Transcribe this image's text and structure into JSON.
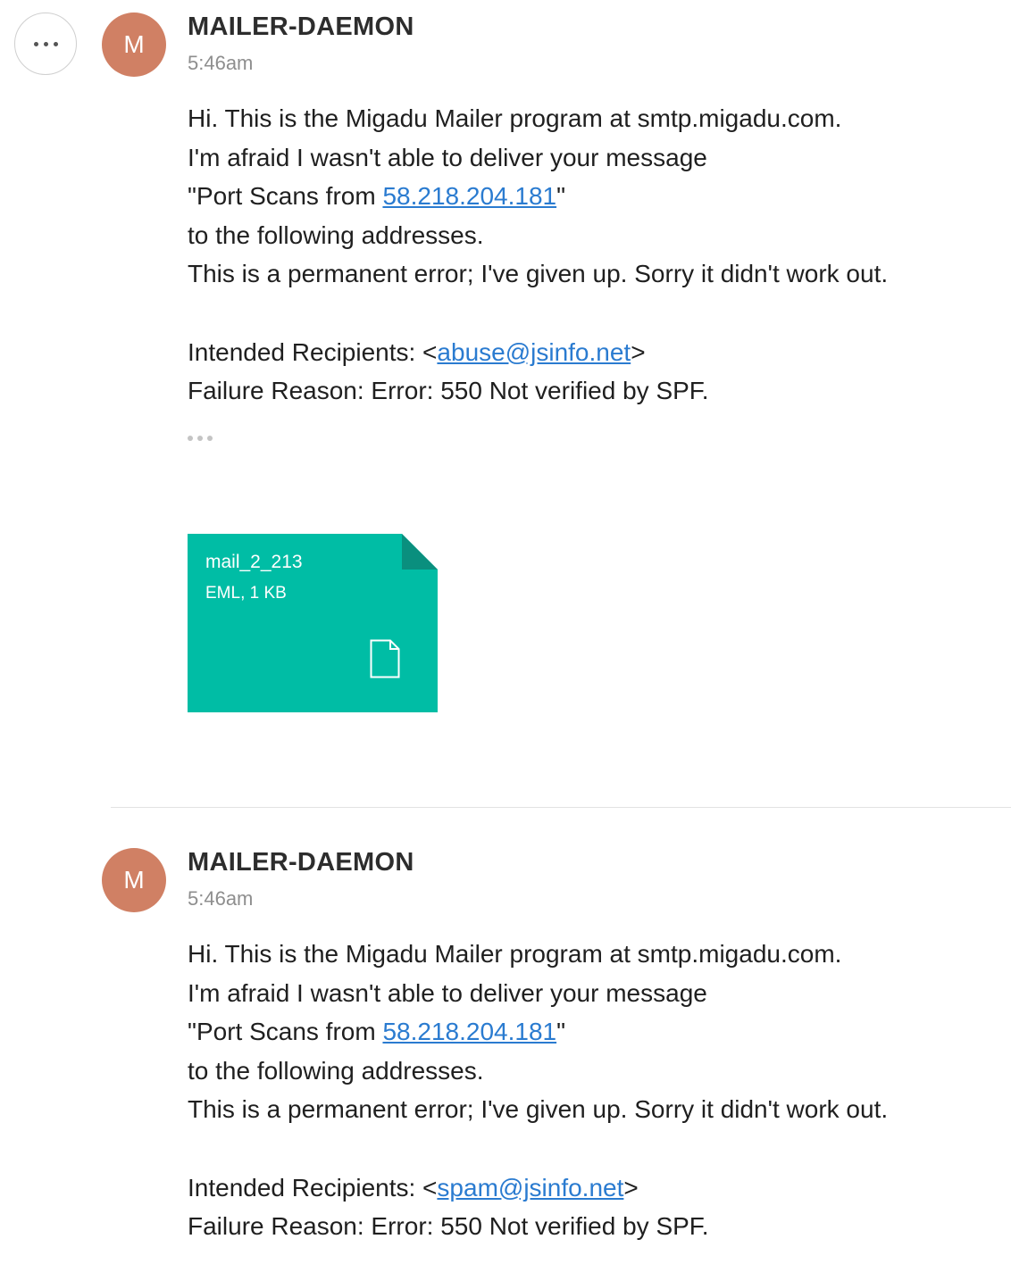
{
  "toolbar": {
    "more_icon": "more-horizontal-icon"
  },
  "messages": [
    {
      "avatar_letter": "M",
      "avatar_color": "#d08064",
      "sender": "MAILER-DAEMON",
      "time": "5:46am",
      "body": {
        "line1": "Hi. This is the Migadu Mailer program at smtp.migadu.com.",
        "line2": "I'm afraid I wasn't able to deliver your message",
        "line3_prefix": "\"Port Scans from ",
        "line3_link": "58.218.204.181",
        "line3_suffix": "\"",
        "line4": "to the following addresses.",
        "line5": "This is a permanent error; I've given up. Sorry it didn't work out.",
        "recipients_prefix": "Intended Recipients: <",
        "recipients_link": "abuse@jsinfo.net",
        "recipients_suffix": ">",
        "failure": "Failure Reason: Error: 550 Not verified by SPF."
      },
      "attachment": {
        "name": "mail_2_213",
        "meta": "EML, 1 KB",
        "color": "#00bda5",
        "icon": "file-icon"
      }
    },
    {
      "avatar_letter": "M",
      "avatar_color": "#d08064",
      "sender": "MAILER-DAEMON",
      "time": "5:46am",
      "body": {
        "line1": "Hi. This is the Migadu Mailer program at smtp.migadu.com.",
        "line2": "I'm afraid I wasn't able to deliver your message",
        "line3_prefix": "\"Port Scans from ",
        "line3_link": "58.218.204.181",
        "line3_suffix": "\"",
        "line4": "to the following addresses.",
        "line5": "This is a permanent error; I've given up. Sorry it didn't work out.",
        "recipients_prefix": "Intended Recipients: <",
        "recipients_link": "spam@jsinfo.net",
        "recipients_suffix": ">",
        "failure": "Failure Reason: Error: 550 Not verified by SPF."
      }
    }
  ],
  "colors": {
    "link": "#2a7bd0",
    "divider": "#e2e2e2"
  }
}
